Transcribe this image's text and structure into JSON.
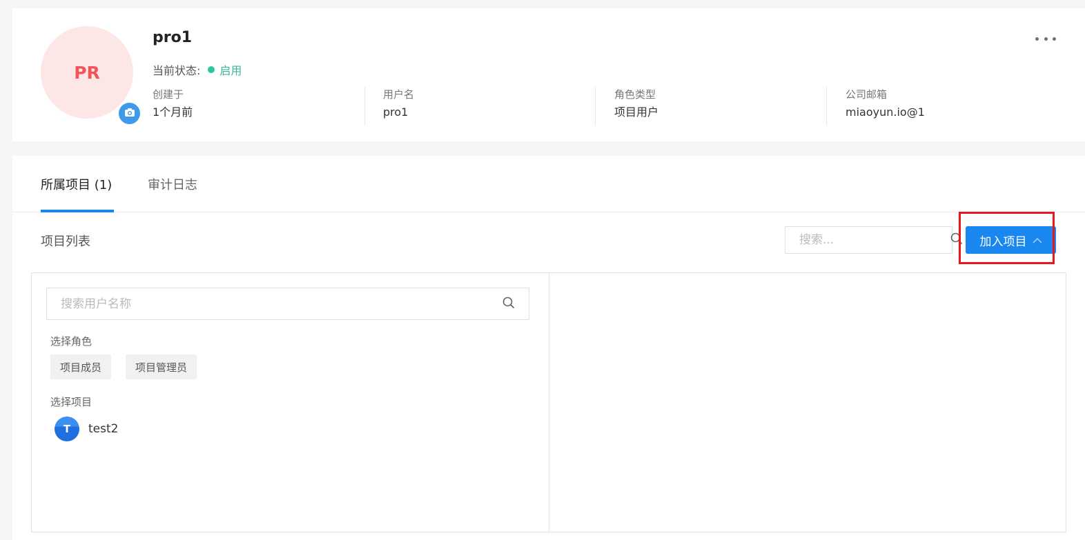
{
  "user": {
    "avatar_initials": "PR",
    "name": "pro1",
    "status_label": "当前状态:",
    "status_value": "启用",
    "status_color": "#2ec5a0",
    "avatar_bg": "#fde6e6",
    "avatar_text_color": "#f0555a"
  },
  "info": [
    {
      "label": "创建于",
      "value": "1个月前"
    },
    {
      "label": "用户名",
      "value": "pro1"
    },
    {
      "label": "角色类型",
      "value": "项目用户"
    },
    {
      "label": "公司邮箱",
      "value": "miaoyun.io@1"
    }
  ],
  "tabs": [
    {
      "label": "所属项目 (1)",
      "active": true
    },
    {
      "label": "审计日志",
      "active": false
    }
  ],
  "section": {
    "title": "项目列表",
    "search_placeholder": "搜索...",
    "join_button": "加入项目"
  },
  "panel": {
    "user_search_placeholder": "搜索用户名称",
    "role_label": "选择角色",
    "roles": [
      "项目成员",
      "项目管理员"
    ],
    "project_label": "选择项目",
    "projects": [
      {
        "initial": "T",
        "name": "test2"
      }
    ]
  },
  "colors": {
    "primary": "#1a86f0",
    "highlight": "#e8151c"
  },
  "icons": {
    "camera": "camera-icon",
    "more": "more-horizontal-icon",
    "search": "search-icon",
    "chevron": "chevron-up-icon"
  }
}
